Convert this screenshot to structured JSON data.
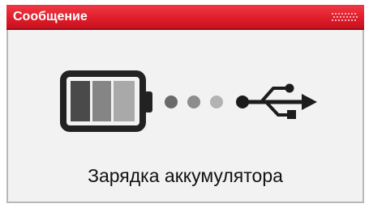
{
  "dialog": {
    "title": "Сообщение",
    "message": "Зарядка аккумулятора",
    "icons": [
      "battery-icon",
      "progress-dots-icon",
      "usb-icon"
    ]
  },
  "colors": {
    "titlebar": "#e01e2c",
    "background": "#f2f2f2",
    "icon_dark": "#222222"
  }
}
